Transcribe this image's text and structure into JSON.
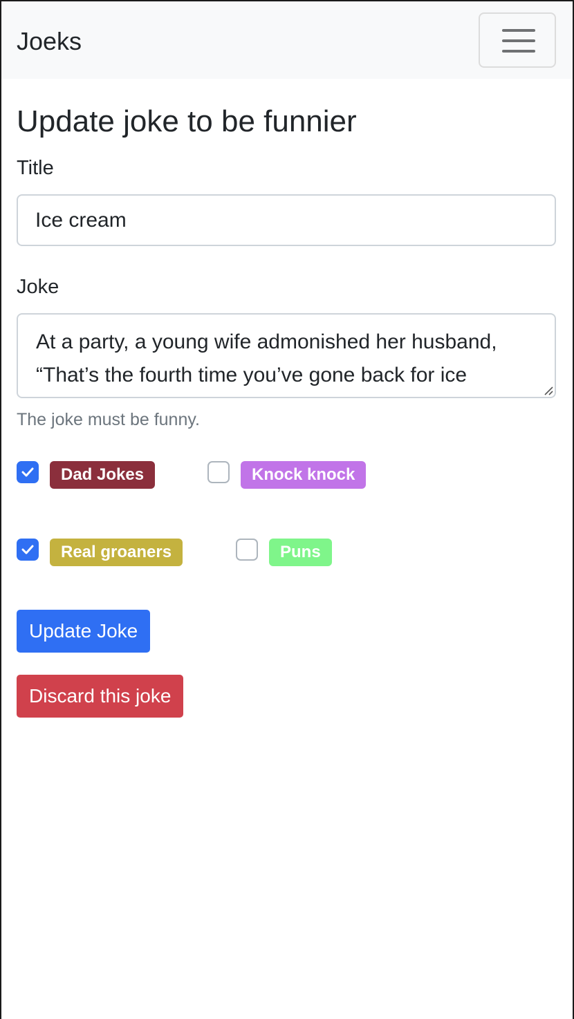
{
  "navbar": {
    "brand": "Joeks",
    "toggler_icon": "hamburger-icon"
  },
  "page": {
    "heading": "Update joke to be funnier"
  },
  "form": {
    "title_label": "Title",
    "title_value": "Ice cream",
    "joke_label": "Joke",
    "joke_value": "At a party, a young wife admonished her husband, “That’s the fourth time you’ve gone back for ice",
    "help_text": "The joke must be funny."
  },
  "tags": [
    {
      "label": "Dad Jokes",
      "checked": true,
      "color": "#8b2f3c"
    },
    {
      "label": "Knock knock",
      "checked": false,
      "color": "#c174e8"
    },
    {
      "label": "Real groaners",
      "checked": true,
      "color": "#c4b23f"
    },
    {
      "label": "Puns",
      "checked": false,
      "color": "#7ff58a"
    }
  ],
  "actions": {
    "update_label": "Update Joke",
    "discard_label": "Discard this joke"
  },
  "colors": {
    "primary": "#2f6ff3",
    "danger": "#d0414c",
    "navbar_bg": "#f8f9fa",
    "muted_text": "#6c757d"
  }
}
